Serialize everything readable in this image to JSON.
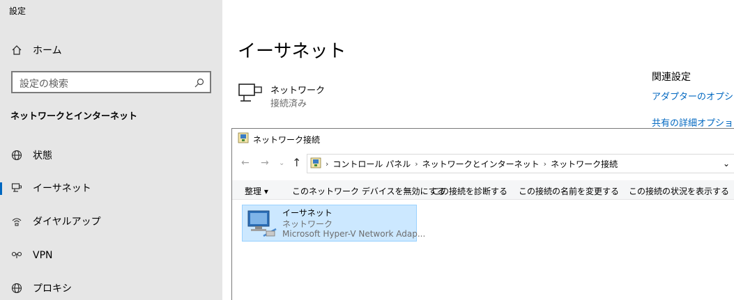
{
  "app": {
    "title": "設定"
  },
  "sidebar": {
    "home": {
      "label": "ホーム",
      "icon": "home-icon"
    },
    "search": {
      "placeholder": "設定の検索",
      "icon": "search-icon"
    },
    "section_title": "ネットワークとインターネット",
    "items": [
      {
        "label": "状態",
        "icon": "globe-status-icon"
      },
      {
        "label": "イーサネット",
        "icon": "ethernet-icon",
        "active": true
      },
      {
        "label": "ダイヤルアップ",
        "icon": "dialup-icon"
      },
      {
        "label": "VPN",
        "icon": "vpn-icon"
      },
      {
        "label": "プロキシ",
        "icon": "globe-icon"
      }
    ],
    "accent": "#0067c0"
  },
  "main": {
    "title": "イーサネット",
    "network": {
      "name": "ネットワーク",
      "status": "接続済み",
      "icon": "network-monitor-icon"
    },
    "related": {
      "heading": "関連設定",
      "links": [
        "アダプターのオプションを",
        "共有の詳細オプション"
      ]
    }
  },
  "control_panel": {
    "title": "ネットワーク接続",
    "address": {
      "crumbs": [
        "コントロール パネル",
        "ネットワークとインターネット",
        "ネットワーク接続"
      ]
    },
    "commands": [
      "整理 ▾",
      "このネットワーク デバイスを無効にする",
      "この接続を診断する",
      "この接続の名前を変更する",
      "この接続の状況を表示する"
    ],
    "adapter": {
      "name": "イーサネット",
      "network": "ネットワーク",
      "device": "Microsoft Hyper-V Network Adap..."
    }
  }
}
